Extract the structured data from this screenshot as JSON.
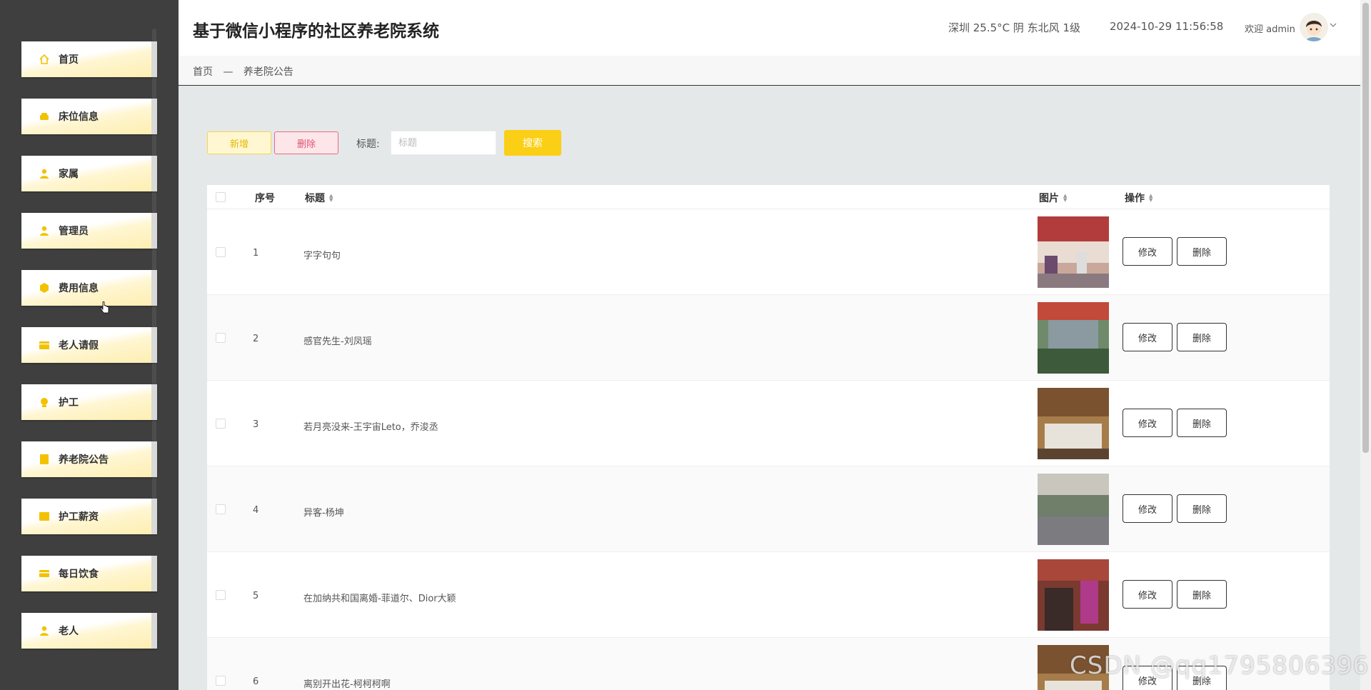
{
  "header": {
    "title": "基于微信小程序的社区养老院系统",
    "weather": "深圳 25.5°C 阴 东北风 1级",
    "datetime": "2024-10-29 11:56:58",
    "welcome": "欢迎 admin"
  },
  "breadcrumb": {
    "home": "首页",
    "sep": "—",
    "current": "养老院公告"
  },
  "sidebar": {
    "items": [
      {
        "label": "首页",
        "icon": "home-icon"
      },
      {
        "label": "床位信息",
        "icon": "bed-icon"
      },
      {
        "label": "家属",
        "icon": "user-icon"
      },
      {
        "label": "管理员",
        "icon": "user-icon"
      },
      {
        "label": "费用信息",
        "icon": "fee-icon"
      },
      {
        "label": "老人请假",
        "icon": "calendar-icon"
      },
      {
        "label": "护工",
        "icon": "nurse-icon"
      },
      {
        "label": "养老院公告",
        "icon": "notice-icon"
      },
      {
        "label": "护工薪资",
        "icon": "salary-icon"
      },
      {
        "label": "每日饮食",
        "icon": "meal-icon"
      },
      {
        "label": "老人",
        "icon": "user-icon"
      }
    ]
  },
  "toolbar": {
    "add_label": "新增",
    "delete_label": "删除",
    "search_label": "标题:",
    "search_placeholder": "标题",
    "search_button": "搜索"
  },
  "table": {
    "columns": {
      "index": "序号",
      "title": "标题",
      "image": "图片",
      "actions": "操作"
    },
    "edit_label": "修改",
    "delete_label": "删除",
    "rows": [
      {
        "index": "1",
        "title": "字字句句"
      },
      {
        "index": "2",
        "title": "感官先生-刘凤瑶"
      },
      {
        "index": "3",
        "title": "若月亮没来-王宇宙Leto，乔浚丞"
      },
      {
        "index": "4",
        "title": "异客-杨坤"
      },
      {
        "index": "5",
        "title": "在加纳共和国离婚-菲道尔、Dior大颖"
      },
      {
        "index": "6",
        "title": "离别开出花-柯柯柯啊"
      }
    ]
  },
  "watermark": "CSDN @qq1795806396",
  "colors": {
    "accent": "#fbcf15",
    "sidebar": "#3f3f3f",
    "danger": "#e05470"
  }
}
